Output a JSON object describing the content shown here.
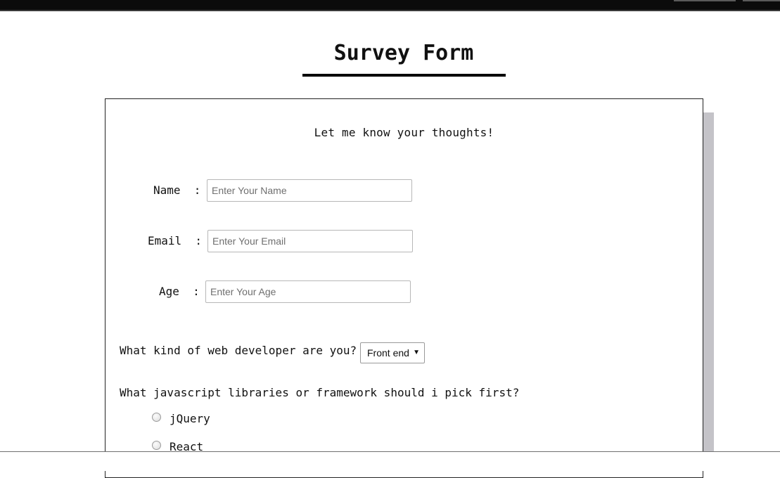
{
  "page": {
    "title": "Survey Form",
    "subtitle": "Let me know your thoughts!"
  },
  "form": {
    "name": {
      "label": "Name  :",
      "placeholder": "Enter Your Name",
      "value": ""
    },
    "email": {
      "label": "Email  :",
      "placeholder": "Enter Your Email",
      "value": ""
    },
    "age": {
      "label": "Age  :",
      "placeholder": "Enter Your Age",
      "value": ""
    },
    "developer_type": {
      "question": "What kind of web developer are you?",
      "selected": "Front end",
      "arrow": "▼"
    },
    "libraries": {
      "question": "What javascript libraries or framework should i pick first?",
      "options": [
        {
          "label": "jQuery",
          "checked": false
        },
        {
          "label": "React",
          "checked": false
        }
      ]
    }
  },
  "colors": {
    "title_underline": "#000000",
    "card_shadow": "#c4c3c8",
    "top_bar": "#0b0b0b"
  }
}
